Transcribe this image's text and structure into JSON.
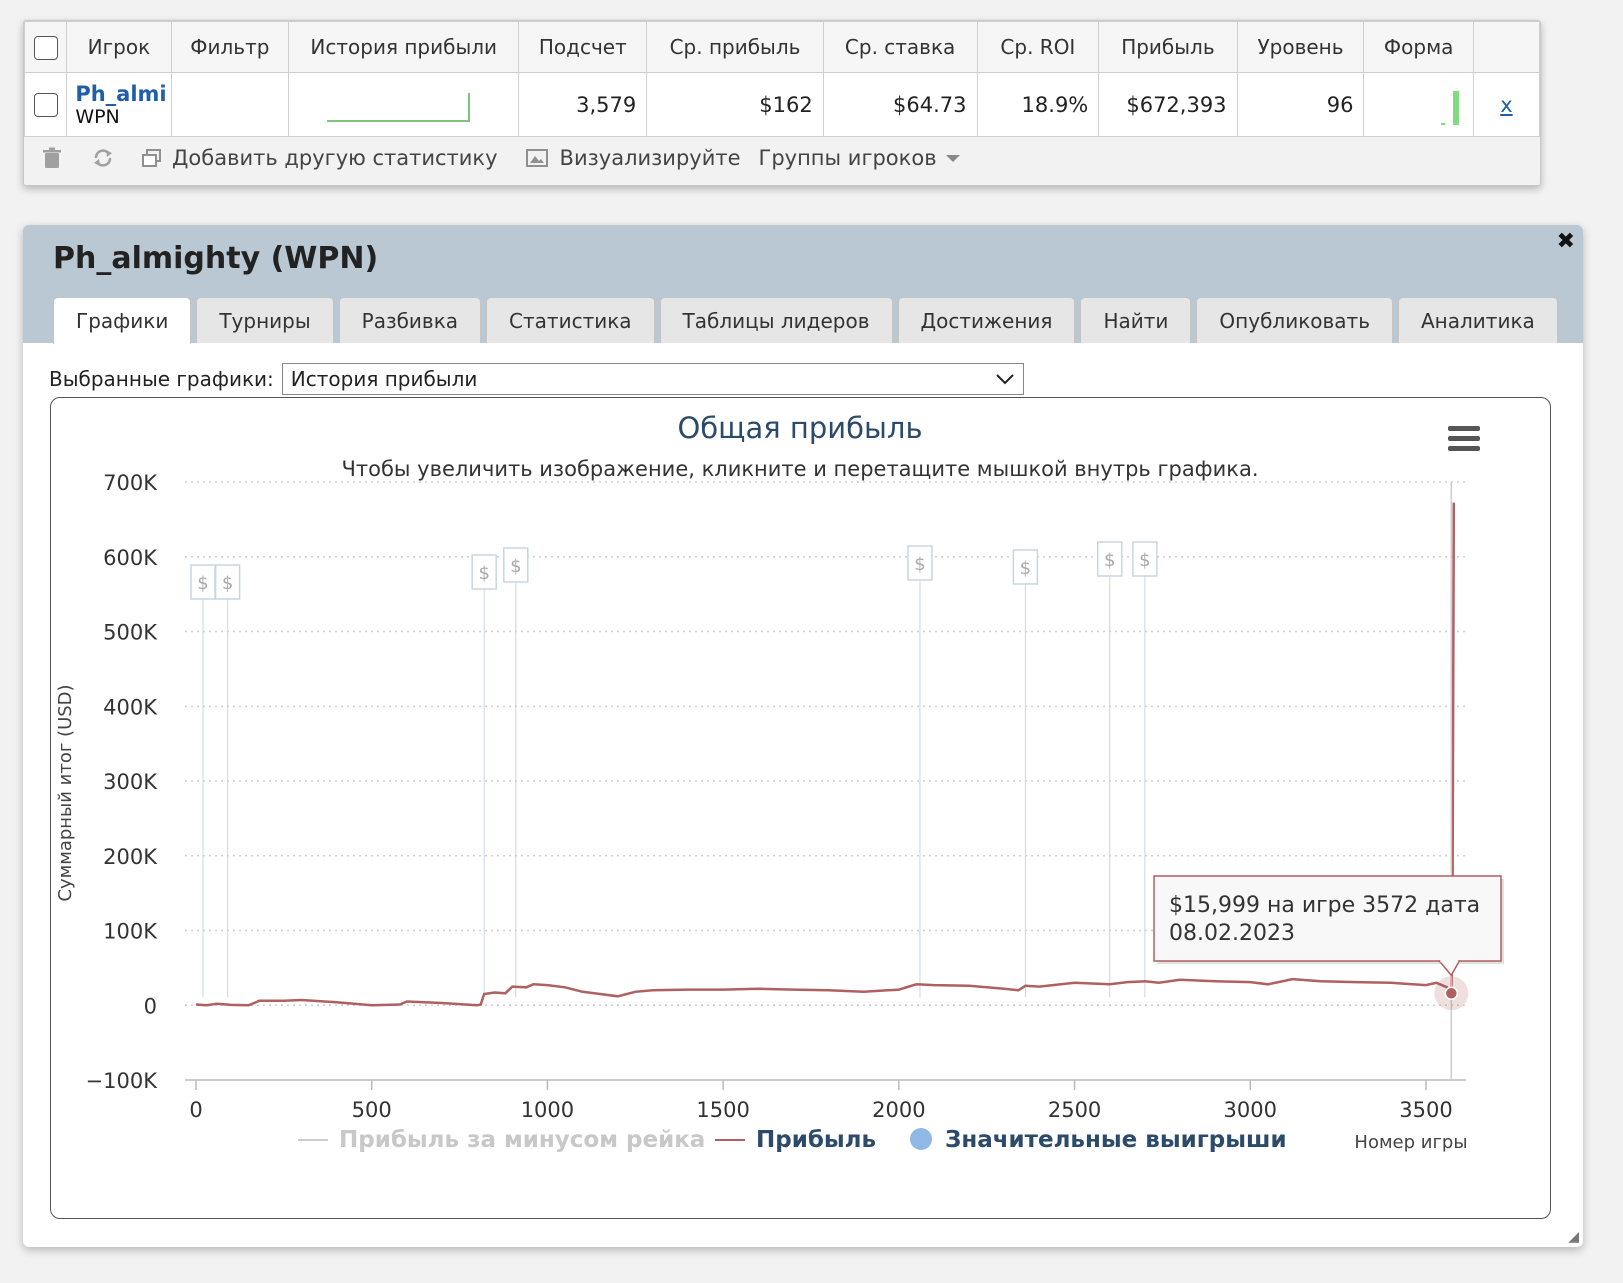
{
  "stats_table": {
    "headers": [
      "Игрок",
      "Фильтр",
      "История прибыли",
      "Подсчет",
      "Ср. прибыль",
      "Ср. ставка",
      "Ср. ROI",
      "Прибыль",
      "Уровень",
      "Форма"
    ],
    "row": {
      "player": "Ph_almi",
      "site": "WPN",
      "filter": "",
      "count": "3,579",
      "avg_profit": "$162",
      "avg_stake": "$64.73",
      "avg_roi": "18.9%",
      "profit": "$672,393",
      "level": "96",
      "remove": "x"
    }
  },
  "toolbar": {
    "add_stats": "Добавить другую статистику",
    "visualize": "Визуализируйте",
    "player_groups": "Группы игроков"
  },
  "panel": {
    "title": "Ph_almighty (WPN)",
    "tabs": [
      "Графики",
      "Турниры",
      "Разбивка",
      "Статистика",
      "Таблицы лидеров",
      "Достижения",
      "Найти",
      "Опубликовать",
      "Аналитика"
    ],
    "active_tab": "Графики",
    "chart_select_label": "Выбранные графики:",
    "chart_select_value": "История прибыли"
  },
  "chart_data": {
    "type": "line",
    "title": "Общая прибыль",
    "subtitle": "Чтобы увеличить изображение, кликните и перетащите мышкой внутрь графика.",
    "ylabel": "Суммарный итог (USD)",
    "xlabel": "Номер игры",
    "ylim": [
      -100000,
      700000
    ],
    "xlim": [
      0,
      3600
    ],
    "yticks": [
      "700K",
      "600K",
      "500K",
      "400K",
      "300K",
      "200K",
      "100K",
      "0",
      "−100K"
    ],
    "xticks": [
      "0",
      "500",
      "1000",
      "1500",
      "2000",
      "2500",
      "3000",
      "3500"
    ],
    "legend": [
      "Прибыль за минусом рейка",
      "Прибыль",
      "Значительные выигрыши"
    ],
    "legend_position": "bottom",
    "colors": {
      "profit": "#b06060",
      "no_rake": "#cccccc",
      "big_wins": "#8fb8e6"
    },
    "series": [
      {
        "name": "Прибыль",
        "x": [
          0,
          30,
          60,
          100,
          150,
          180,
          250,
          300,
          400,
          500,
          580,
          600,
          700,
          800,
          810,
          820,
          850,
          880,
          900,
          940,
          960,
          1000,
          1050,
          1100,
          1150,
          1200,
          1250,
          1300,
          1400,
          1500,
          1600,
          1700,
          1800,
          1900,
          2000,
          2050,
          2100,
          2200,
          2300,
          2340,
          2360,
          2400,
          2500,
          2600,
          2650,
          2700,
          2740,
          2800,
          2900,
          3000,
          3050,
          3080,
          3120,
          3200,
          3300,
          3400,
          3500,
          3530,
          3560,
          3572,
          3575,
          3579
        ],
        "y": [
          1000,
          0,
          2000,
          500,
          0,
          6000,
          6000,
          7000,
          4000,
          0,
          1000,
          5000,
          3000,
          0,
          1000,
          15000,
          17000,
          16000,
          25000,
          24000,
          28000,
          27000,
          24000,
          18000,
          15000,
          12000,
          18000,
          20000,
          21000,
          21000,
          22000,
          21000,
          20000,
          18000,
          21000,
          28000,
          27000,
          26000,
          22000,
          20000,
          26000,
          25000,
          30000,
          28000,
          31000,
          32000,
          30000,
          34000,
          32000,
          31000,
          28000,
          31000,
          35000,
          32000,
          31000,
          30000,
          27000,
          30000,
          24000,
          15999,
          80000,
          672393
        ]
      }
    ],
    "big_wins_x": [
      20,
      90,
      820,
      910,
      2060,
      2360,
      2600,
      2700
    ],
    "tooltip": {
      "line1": "$15,999 на игре 3572 дата",
      "line2": "08.02.2023"
    }
  }
}
